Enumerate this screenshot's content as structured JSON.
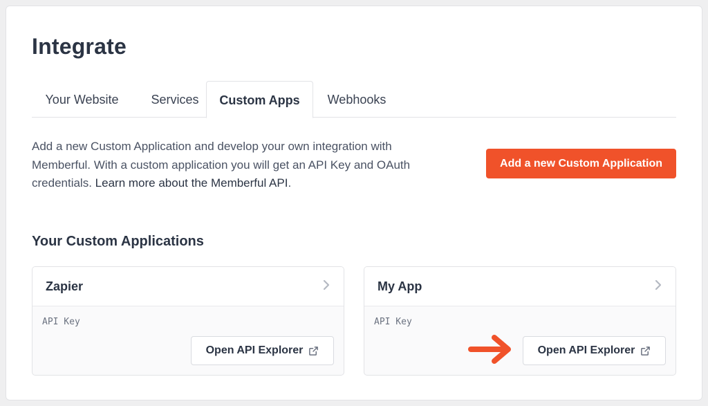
{
  "page": {
    "title": "Integrate"
  },
  "tabs": [
    {
      "label": "Your Website",
      "active": false
    },
    {
      "label": "Services",
      "active": false
    },
    {
      "label": "Custom Apps",
      "active": true
    },
    {
      "label": "Webhooks",
      "active": false
    }
  ],
  "intro": {
    "text": "Add a new Custom Application and develop your own integration with Memberful. With a custom application you will get an API Key and OAuth credentials. ",
    "link": "Learn more about the Memberful API",
    "suffix": "."
  },
  "add_button": {
    "label": "Add a new Custom Application"
  },
  "section": {
    "title": "Your Custom Applications"
  },
  "apps": [
    {
      "name": "Zapier",
      "api_key_label": "API Key",
      "button_label": "Open API Explorer"
    },
    {
      "name": "My App",
      "api_key_label": "API Key",
      "button_label": "Open API Explorer"
    }
  ],
  "icons": {
    "chevron": "chevron-right-icon",
    "external": "external-link-icon",
    "annotation": "arrow-right-icon"
  },
  "colors": {
    "accent": "#f0522a",
    "text": "#2b3444",
    "border": "#e2e3e6"
  }
}
